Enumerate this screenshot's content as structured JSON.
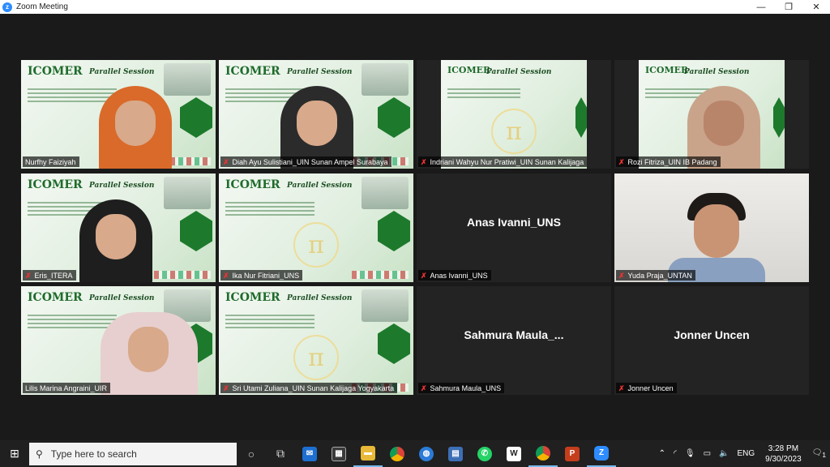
{
  "window": {
    "title": "Zoom Meeting",
    "minimize": "—",
    "maximize": "❐",
    "close": "✕"
  },
  "slide": {
    "logo": "ICOMER",
    "heading": "Parallel Session"
  },
  "tiles": [
    {
      "name": "Nurfhy Faiziyah",
      "type": "video-slide-person"
    },
    {
      "name": "Diah Ayu Sulistiani_UIN Sunan Ampel Surabaya",
      "type": "video-slide-person"
    },
    {
      "name": "Indriani Wahyu Nur Pratiwi_UIN Sunan Kalijaga",
      "type": "video-slide"
    },
    {
      "name": "Rozi Fitriza_UIN IB Padang",
      "type": "video-slide-person"
    },
    {
      "name": "Eris_ITERA",
      "type": "video-slide-person"
    },
    {
      "name": "Ika Nur Fitriani_UNS",
      "type": "video-slide"
    },
    {
      "name": "Anas Ivanni_UNS",
      "display": "Anas Ivanni_UNS",
      "type": "name-only"
    },
    {
      "name": "Yuda Praja_UNTAN",
      "type": "video"
    },
    {
      "name": "Lilis Marina Angraini_UIR",
      "type": "video-slide-person"
    },
    {
      "name": "Sri Utami Zuliana_UIN Sunan Kalijaga Yogyakarta",
      "type": "video-slide"
    },
    {
      "name": "Sahmura Maula_UNS",
      "display": "Sahmura Maula_...",
      "type": "name-only"
    },
    {
      "name": "Jonner Uncen",
      "display": "Jonner Uncen",
      "type": "name-only"
    }
  ],
  "taskbar": {
    "search_placeholder": "Type here to search",
    "language": "ENG",
    "time": "3:28 PM",
    "date": "9/30/2023",
    "notifications": "1"
  },
  "colors": {
    "accent": "#2d8cff",
    "active_speaker": "#e8e24a",
    "muted": "#e33333"
  }
}
